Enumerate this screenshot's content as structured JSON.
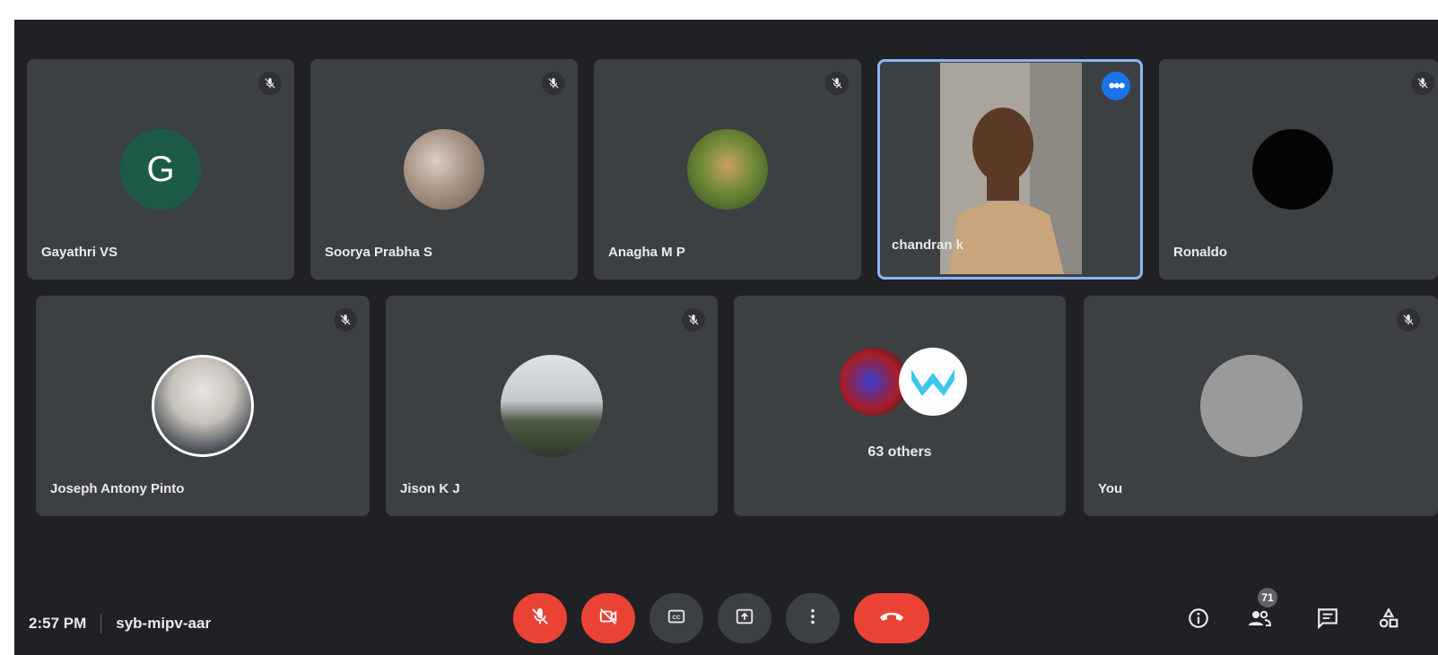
{
  "participants_row1": [
    {
      "name": "Gayathri VS",
      "avatar_letter": "G"
    },
    {
      "name": "Soorya Prabha S"
    },
    {
      "name": "Anagha M P"
    },
    {
      "name": "chandran k"
    },
    {
      "name": "Ronaldo"
    }
  ],
  "participants_row2": [
    {
      "name": "Joseph Antony Pinto"
    },
    {
      "name": "Jison K J"
    },
    {
      "others_label": "63 others"
    },
    {
      "name": "You"
    }
  ],
  "meeting": {
    "time": "2:57 PM",
    "code": "syb-mipv-aar"
  },
  "people_count": "71",
  "colors": {
    "accent_blue": "#1a73e8",
    "active_border": "#8ab4f8",
    "end_call_red": "#ea4335",
    "tile_bg": "#3c4043",
    "stage_bg": "#202124"
  },
  "icons": {
    "mic_off": "mic-off-icon",
    "cam_off": "videocam-off-icon",
    "captions": "closed-caption-icon",
    "present": "present-screen-icon",
    "more": "more-vert-icon",
    "end_call": "call-end-icon",
    "info": "info-icon",
    "people": "people-icon",
    "chat": "chat-icon",
    "activities": "activities-icon"
  }
}
